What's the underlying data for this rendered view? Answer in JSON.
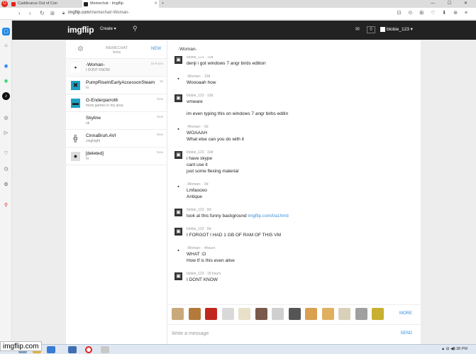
{
  "browser": {
    "tabs": [
      {
        "title": "Caddicarus Out of Con",
        "color": "#e2231a"
      },
      {
        "title": "Memechat - Imgflip",
        "color": "#222222"
      }
    ],
    "url_host": "imgflip.com",
    "url_path": "/memechat/-Woman-"
  },
  "header": {
    "logo": "imgflip",
    "create_label": "Create ▾",
    "notification_count": "0",
    "username": "blobie_123 ▾"
  },
  "sidebar": {
    "gear_label": "⚙",
    "title_line1": "MEMECHAT",
    "title_line2": "beta",
    "new_label": "NEW",
    "conversations": [
      {
        "name": "-Woman-",
        "sub": "I DONT KNOW",
        "time": "18 hours",
        "avatar_color": "#ffffff",
        "avatar_glyph": "▪"
      },
      {
        "name": "PumpRiseInEarlyAccessonSteam",
        "sub": "hi",
        "time": "3d",
        "avatar_color": "#1ca0c4",
        "avatar_glyph": "✖"
      },
      {
        "name": "G-Enderparrot6",
        "sub": "more games in my area",
        "time": "New",
        "avatar_color": "#1ca0c4",
        "avatar_glyph": "▬"
      },
      {
        "name": "Skyline",
        "sub": "ok",
        "time": "New",
        "avatar_color": "#ffffff",
        "avatar_glyph": ""
      },
      {
        "name": "CinnaBruh.AVI",
        "sub": "cinghight",
        "time": "New",
        "avatar_color": "#ffffff",
        "avatar_glyph": "╬"
      },
      {
        "name": "[deleted]",
        "sub": "hi",
        "time": "New",
        "avatar_color": "#dddddd",
        "avatar_glyph": "●"
      }
    ]
  },
  "chat": {
    "title": "-Woman-",
    "messages": [
      {
        "who": "blobie_123 · 10d",
        "lines": [
          "denji  i got windows 7 angr birds edition"
        ],
        "me": true
      },
      {
        "who": "-Woman- · 10d",
        "lines": [
          "Woooaah how"
        ],
        "me": false
      },
      {
        "who": "blobie_123 · 10d",
        "lines": [
          "vmware",
          "im even typing this on windows 7 angr birbs editin"
        ],
        "me": true
      },
      {
        "who": "-Woman- · 9d",
        "lines": [
          "WOAAAH",
          "What else can you do with it"
        ],
        "me": false
      },
      {
        "who": "blobie_123 · 10d",
        "lines": [
          "i have skype",
          "cant use it",
          "just some flexing material"
        ],
        "me": true
      },
      {
        "who": "-Woman- · 9d",
        "lines": [
          "Lmfaoooo",
          "Antique"
        ],
        "me": false
      },
      {
        "who": "blobie_123 · 8d",
        "lines": [
          "look at this funny background "
        ],
        "link": "imgflip.com/i/a1hmti",
        "me": true
      },
      {
        "who": "blobie_123 · 8d",
        "lines": [
          "I FORGOT I HAD 1 GB OF RAM OF THIS VM"
        ],
        "me": true
      },
      {
        "who": "-Woman- · 4hours",
        "lines": [
          "WHAT :O",
          "How tf is this even alive"
        ],
        "me": false
      },
      {
        "who": "blobie_123 · 18 hours",
        "lines": [
          "I DONT KNOW"
        ],
        "me": true
      }
    ],
    "emoji_colors": [
      "#c9a97a",
      "#b37a3a",
      "#c0281e",
      "#d9d9d9",
      "#e8e0c8",
      "#7a5a4a",
      "#cfcfcf",
      "#555555",
      "#d9a050",
      "#e0b060",
      "#d8d0b8",
      "#a0a0a0",
      "#c8b030"
    ],
    "more_label": "MORE",
    "compose_placeholder": "Write a message",
    "send_label": "SEND"
  },
  "taskbar": {
    "status_url": "imgflip.com",
    "tray": "▲ ⊟ ◀)",
    "clock": "6:38 PM"
  }
}
